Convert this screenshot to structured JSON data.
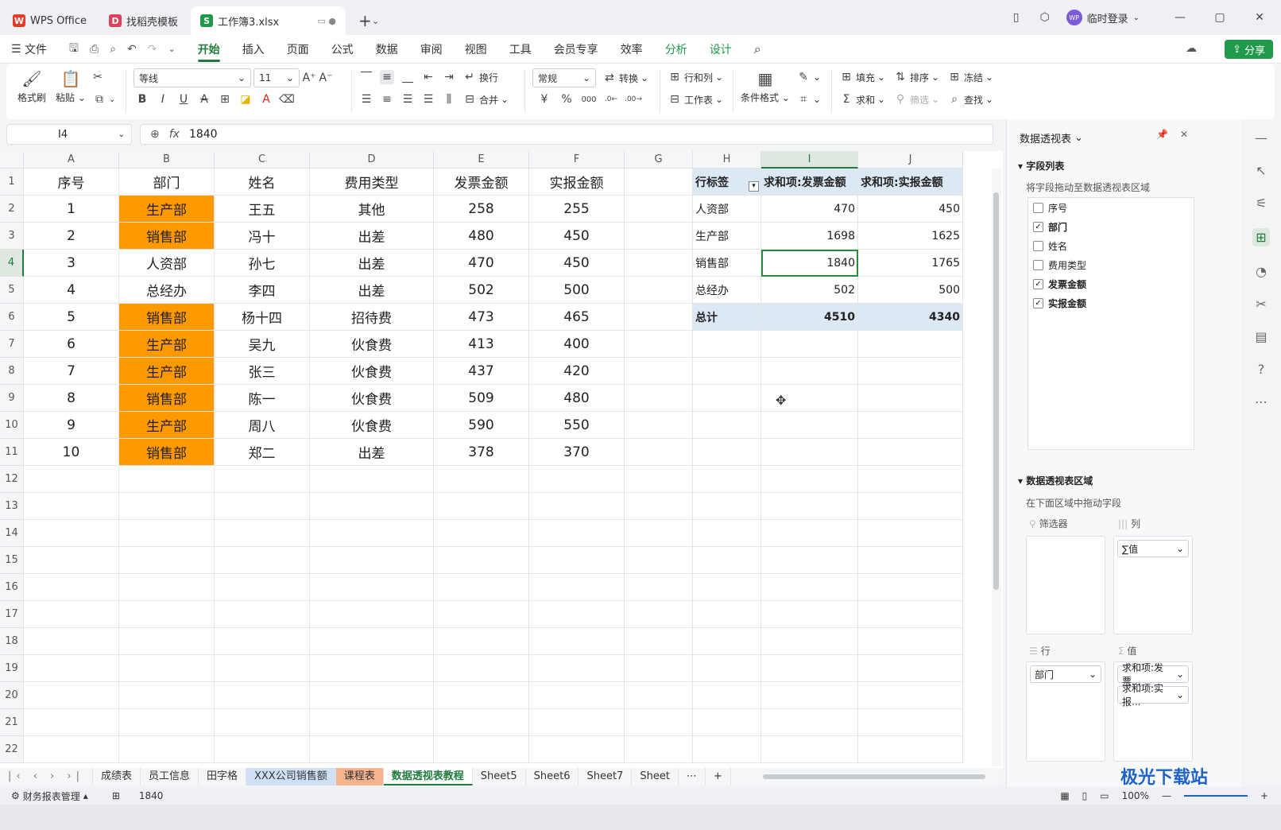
{
  "titlebar": {
    "tabs": [
      {
        "label": "WPS Office",
        "logo": "W",
        "logo_color": "#e03b2b"
      },
      {
        "label": "找稻壳模板",
        "logo": "D",
        "logo_color": "#e0405a"
      },
      {
        "label": "工作簿3.xlsx",
        "logo": "S",
        "logo_color": "#1f9a4a"
      }
    ],
    "login_label": "临时登录",
    "avatar_text": "WP"
  },
  "menubar": {
    "items": [
      "文件",
      "开始",
      "插入",
      "页面",
      "公式",
      "数据",
      "审阅",
      "视图",
      "工具",
      "会员专享",
      "效率",
      "分析",
      "设计"
    ],
    "share_label": "分享"
  },
  "ribbon": {
    "format_painter": "格式刷",
    "paste": "粘贴",
    "font_name": "等线",
    "font_size": "11",
    "wrap": "换行",
    "merge": "合并",
    "number_format": "常规",
    "convert": "转换",
    "row_col": "行和列",
    "worksheet": "工作表",
    "cond_format": "条件格式",
    "fill": "填充",
    "sort": "排序",
    "freeze": "冻结",
    "sum": "求和",
    "filter": "筛选",
    "find": "查找"
  },
  "formula": {
    "cell_ref": "I4",
    "fx": "fx",
    "value": "1840"
  },
  "columns": [
    "A",
    "B",
    "C",
    "D",
    "E",
    "F",
    "G",
    "H",
    "I",
    "J"
  ],
  "rows": [
    "1",
    "2",
    "3",
    "4",
    "5",
    "6",
    "7",
    "8",
    "9",
    "10",
    "11",
    "12",
    "13",
    "14",
    "15",
    "16",
    "17",
    "18",
    "19",
    "20",
    "21",
    "22"
  ],
  "table": {
    "headers": [
      "序号",
      "部门",
      "姓名",
      "费用类型",
      "发票金额",
      "实报金额"
    ],
    "rows": [
      [
        "1",
        "生产部",
        "王五",
        "其他",
        "258",
        "255"
      ],
      [
        "2",
        "销售部",
        "冯十",
        "出差",
        "480",
        "450"
      ],
      [
        "3",
        "人资部",
        "孙七",
        "出差",
        "470",
        "450"
      ],
      [
        "4",
        "总经办",
        "李四",
        "出差",
        "502",
        "500"
      ],
      [
        "5",
        "销售部",
        "杨十四",
        "招待费",
        "473",
        "465"
      ],
      [
        "6",
        "生产部",
        "吴九",
        "伙食费",
        "413",
        "400"
      ],
      [
        "7",
        "生产部",
        "张三",
        "伙食费",
        "437",
        "420"
      ],
      [
        "8",
        "销售部",
        "陈一",
        "伙食费",
        "509",
        "480"
      ],
      [
        "9",
        "生产部",
        "周八",
        "伙食费",
        "590",
        "550"
      ],
      [
        "10",
        "销售部",
        "郑二",
        "出差",
        "378",
        "370"
      ]
    ],
    "highlight_color": "#ff9900"
  },
  "pivot": {
    "headers": [
      "行标签",
      "求和项:发票金额",
      "求和项:实报金额"
    ],
    "rows": [
      [
        "人资部",
        "470",
        "450"
      ],
      [
        "生产部",
        "1698",
        "1625"
      ],
      [
        "销售部",
        "1840",
        "1765"
      ],
      [
        "总经办",
        "502",
        "500"
      ]
    ],
    "total": [
      "总计",
      "4510",
      "4340"
    ]
  },
  "sheet_tabs": [
    "成绩表",
    "员工信息",
    "田字格",
    "XXX公司销售额",
    "课程表",
    "数据透视表教程",
    "Sheet5",
    "Sheet6",
    "Sheet7",
    "Sheet"
  ],
  "status": {
    "macro": "财务报表管理",
    "value": "1840",
    "zoom": "100%"
  },
  "panel": {
    "title": "数据透视表",
    "field_list_title": "字段列表",
    "field_list_hint": "将字段拖动至数据透视表区域",
    "fields": [
      {
        "name": "序号",
        "checked": ""
      },
      {
        "name": "部门",
        "checked": "✓"
      },
      {
        "name": "姓名",
        "checked": ""
      },
      {
        "name": "费用类型",
        "checked": ""
      },
      {
        "name": "发票金额",
        "checked": "✓"
      },
      {
        "name": "实报金额",
        "checked": "✓"
      }
    ],
    "areas_title": "数据透视表区域",
    "areas_hint": "在下面区域中拖动字段",
    "filter_label": "筛选器",
    "col_label": "列",
    "row_label": "行",
    "value_label": "值",
    "col_item": "∑值",
    "row_item": "部门",
    "value_items": [
      "求和项:发票...",
      "求和项:实报..."
    ]
  },
  "watermark": "极光下载站"
}
